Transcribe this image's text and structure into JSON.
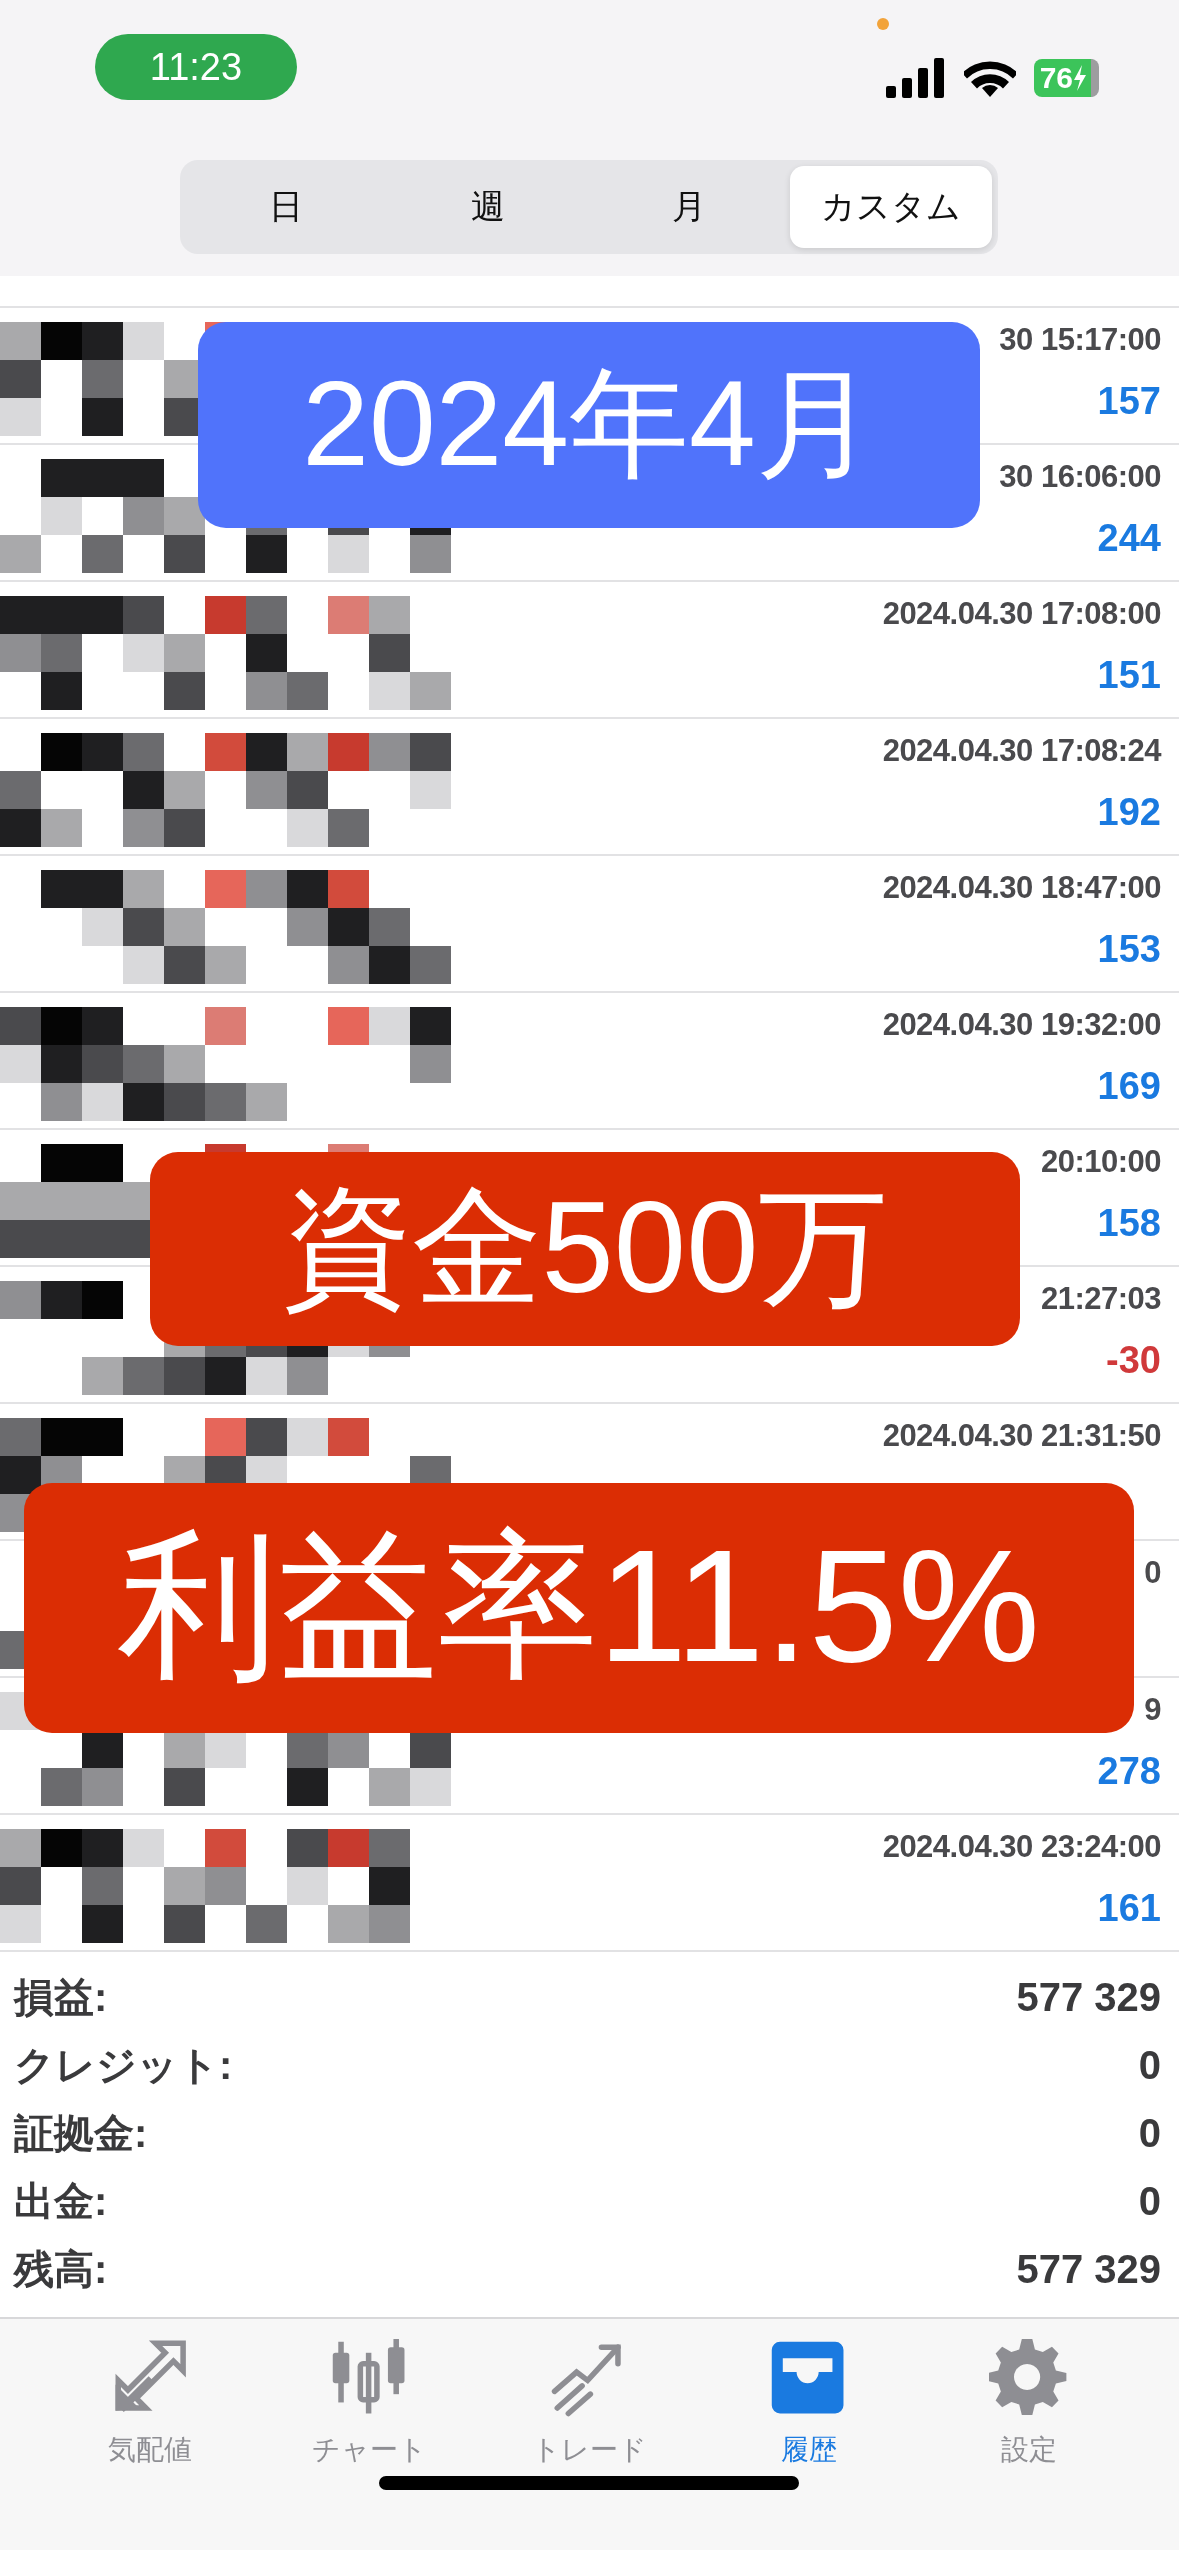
{
  "status_bar": {
    "time": "11:23",
    "battery": "76"
  },
  "segments": [
    {
      "label": "日",
      "selected": false
    },
    {
      "label": "週",
      "selected": false
    },
    {
      "label": "月",
      "selected": false
    },
    {
      "label": "カスタム",
      "selected": true
    }
  ],
  "deals": [
    {
      "time": "30 15:17:00",
      "profit": "157",
      "loss": false
    },
    {
      "time": "30 16:06:00",
      "profit": "244",
      "loss": false
    },
    {
      "time": "2024.04.30 17:08:00",
      "profit": "151",
      "loss": false
    },
    {
      "time": "2024.04.30 17:08:24",
      "profit": "192",
      "loss": false
    },
    {
      "time": "2024.04.30 18:47:00",
      "profit": "153",
      "loss": false
    },
    {
      "time": "2024.04.30 19:32:00",
      "profit": "169",
      "loss": false
    },
    {
      "time": "20:10:00",
      "profit": "158",
      "loss": false
    },
    {
      "time": "21:27:03",
      "profit": "-30",
      "loss": true
    },
    {
      "time": "2024.04.30 21:31:50"
    },
    {
      "time": "0"
    },
    {
      "time": "9",
      "profit": "278",
      "loss": false
    },
    {
      "time": "2024.04.30 23:24:00",
      "profit": "161",
      "loss": false
    }
  ],
  "summary": [
    {
      "label": "損益:",
      "value": "577 329"
    },
    {
      "label": "クレジット:",
      "value": "0"
    },
    {
      "label": "証拠金:",
      "value": "0"
    },
    {
      "label": "出金:",
      "value": "0"
    },
    {
      "label": "残高:",
      "value": "577 329"
    }
  ],
  "banners": [
    {
      "text": "2024年4月",
      "kind": "blue"
    },
    {
      "text": "資金500万",
      "kind": "red"
    },
    {
      "text": "利益率11.5%",
      "kind": "red"
    }
  ],
  "tab_bar": [
    {
      "label": "気配値",
      "kind": "arrows",
      "selected": false
    },
    {
      "label": "チャート",
      "kind": "candles",
      "selected": false
    },
    {
      "label": "トレード",
      "kind": "trend",
      "selected": false
    },
    {
      "label": "履歴",
      "kind": "tray",
      "selected": true
    },
    {
      "label": "設定",
      "kind": "gear",
      "selected": false
    }
  ]
}
